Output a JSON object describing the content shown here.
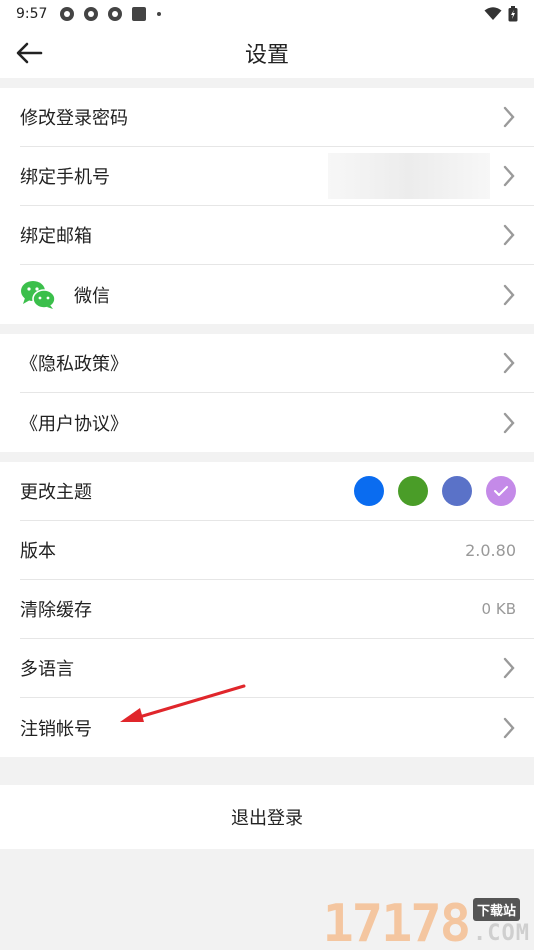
{
  "status_bar": {
    "time": "9:57"
  },
  "header": {
    "title": "设置"
  },
  "account_group": [
    {
      "label": "修改登录密码"
    },
    {
      "label": "绑定手机号"
    },
    {
      "label": "绑定邮箱"
    },
    {
      "label": "微信"
    }
  ],
  "legal_group": [
    {
      "label": "《隐私政策》"
    },
    {
      "label": "《用户协议》"
    }
  ],
  "app_group": {
    "theme": {
      "label": "更改主题",
      "colors": [
        "#0a6cf0",
        "#4a9d28",
        "#5a72c8",
        "#c48ae8"
      ],
      "selected_index": 3
    },
    "version": {
      "label": "版本",
      "value": "2.0.80"
    },
    "cache": {
      "label": "清除缓存",
      "value": "0 KB"
    },
    "language": {
      "label": "多语言"
    },
    "delete_account": {
      "label": "注销帐号"
    }
  },
  "logout": {
    "label": "退出登录"
  },
  "watermark": {
    "number": "17178",
    "badge": "下载站",
    "suffix": ".COM"
  },
  "colors": {
    "arrow": "#e0262b",
    "wechat": "#3bbf4b",
    "chevron": "#9a9a9a"
  }
}
